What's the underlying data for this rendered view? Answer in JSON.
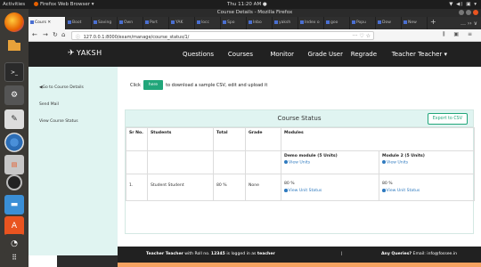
{
  "os": {
    "activities": "Activities",
    "app_label": "Firefox Web Browser ▾",
    "clock": "Thu 11:20 AM ●",
    "tray": "▼ ◀) ▣ ▾"
  },
  "dock_icons": [
    "firefox-icon",
    "files-icon",
    "terminal-icon",
    "settings-icon",
    "editor-icon",
    "chromium-icon",
    "software-icon",
    "disk-icon",
    "writer-icon",
    "store-icon",
    "help-icon",
    "apps-grid-icon"
  ],
  "window": {
    "title": "Course Details - Mozilla Firefox"
  },
  "tabs": [
    "Cours ✕",
    "Boot",
    "Saving",
    "Own",
    "Port",
    "YAK",
    "locc",
    "Spo",
    "Inbo",
    "yaksh",
    "Index o",
    "goo",
    "Popu",
    "Dow",
    "New",
    "+"
  ],
  "tab_tail": "… ›› ∨",
  "url": {
    "value": "127.0.0.1:8000/exam/manage/course_status/1/",
    "right": "··· ♡ ☆"
  },
  "nav_icons_right": "⫼ ▣ ≡",
  "site": {
    "logo": "YAKSH",
    "nav": [
      "Questions",
      "Courses",
      "Monitor",
      "Grade User",
      "Regrade",
      "Teacher Teacher ▾"
    ]
  },
  "sidebar": [
    "◀Go to Course Details",
    "Send Mail",
    "View Course Status"
  ],
  "main": {
    "click_prefix": "Click",
    "here": "here",
    "click_suffix": "to download a sample CSV, edit and upload it",
    "panel_title": "Course Status",
    "export": "Export to CSV",
    "table": {
      "headers": [
        "Sr No.",
        "Students",
        "Total",
        "Grade",
        "Modules"
      ],
      "modules": [
        {
          "name": "Demo module (5 Units)",
          "view": "View Units"
        },
        {
          "name": "Module 2 (5 Units)",
          "view": "View Units"
        }
      ],
      "rows": [
        {
          "sr": "1.",
          "student": "Student Student",
          "total": "80 %",
          "grade": "None",
          "m1": "80 %",
          "m1_link": "View Unit Status",
          "m2": "80 %",
          "m2_link": "View Unit Status"
        }
      ]
    }
  },
  "footer": {
    "prefix": "Teacher Teacher",
    "mid": "with Roll no.",
    "roll": "12345",
    "logged": "is logged in as",
    "role": "teacher",
    "sep": "|",
    "query_label": "Any Queries?",
    "email": "Email: info@fossee.in"
  }
}
